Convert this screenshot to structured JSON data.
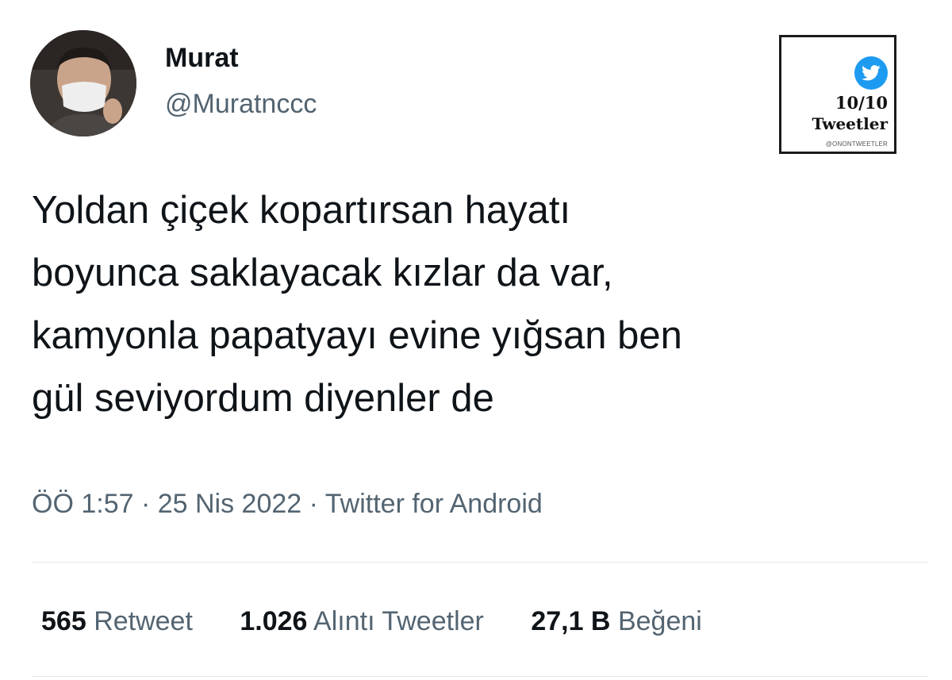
{
  "author": {
    "display_name": "Murat",
    "handle": "@Muratnccc"
  },
  "badge": {
    "score": "10/10",
    "title": "Tweetler",
    "handle": "@ONONTWEETLER",
    "icon": "twitter-bird-icon",
    "accent_color": "#1d9bf0"
  },
  "tweet": {
    "lines": [
      "Yoldan çiçek kopartırsan hayatı",
      "boyunca saklayacak kızlar da var,",
      "kamyonla papatyayı evine yığsan ben",
      "gül seviyordum diyenler de"
    ],
    "meta": "ÖÖ 1:57 · 25 Nis 2022 · Twitter for Android"
  },
  "stats": [
    {
      "count": "565",
      "label": "Retweet"
    },
    {
      "count": "1.026",
      "label": "Alıntı Tweetler"
    },
    {
      "count": "27,1 B",
      "label": "Beğeni"
    }
  ]
}
